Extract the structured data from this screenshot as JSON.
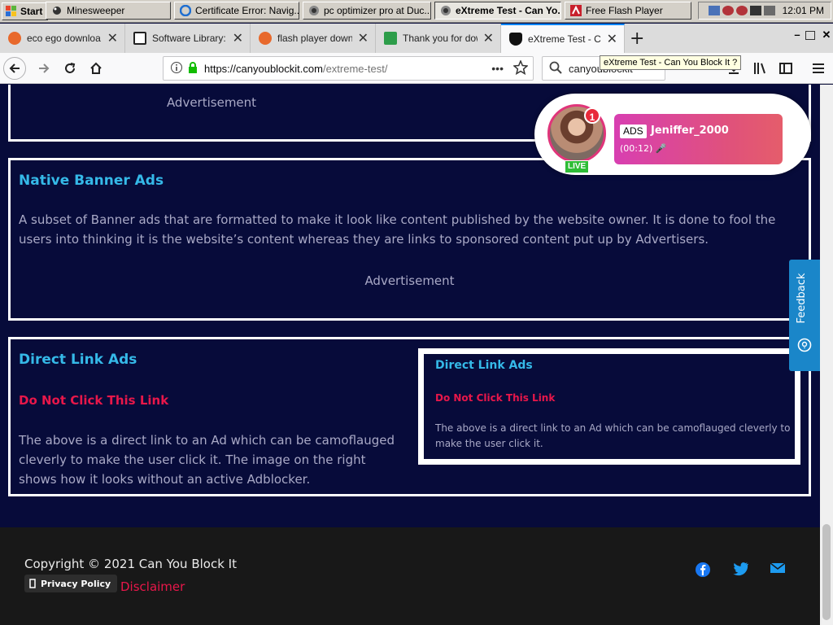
{
  "taskbar": {
    "start_label": "Start",
    "tasks": [
      {
        "label": "Minesweeper"
      },
      {
        "label": "Certificate Error: Navig..."
      },
      {
        "label": "pc optimizer pro at Duc..."
      },
      {
        "label": "eXtreme Test - Can Yo..."
      },
      {
        "label": "Free Flash Player"
      }
    ],
    "clock": "12:01 PM"
  },
  "tabs": [
    {
      "title": "eco ego downloa"
    },
    {
      "title": "Software Library: F"
    },
    {
      "title": "flash player downl"
    },
    {
      "title": "Thank you for dow"
    },
    {
      "title": "eXtreme Test - Can"
    }
  ],
  "navbar": {
    "url_domain": "https://canyoublockit.com",
    "url_path": "/extreme-test/",
    "search_value": "canyoublockit",
    "tooltip": "eXtreme Test - Can You Block It ?"
  },
  "page": {
    "top_ad_label": "Advertisement",
    "native": {
      "title": "Native Banner Ads",
      "text_line1": "A subset of Banner ads that are formatted to make it look like content published by the website owner. It is done to fool the",
      "text_line2": "users into thinking it is the website’s content whereas they are links to sponsored content put up by Advertisers.",
      "ad_label": "Advertisement"
    },
    "direct": {
      "title": "Direct Link Ads",
      "link": "Do Not Click This Link",
      "text_line1": "The above is a direct link to an Ad which can be camoflauged",
      "text_line2": "cleverly to make the user click it. The image on the right",
      "text_line3": "shows how it looks without an active Adblocker.",
      "preview_title": "Direct Link Ads",
      "preview_link": "Do Not Click This Link",
      "preview_line1": "The above is a direct link to an Ad which can be camoflauged cleverly to",
      "preview_line2": "make the user click it."
    },
    "live_widget": {
      "notif_count": "1",
      "live": "LIVE",
      "ads": "ADS",
      "user": "Jeniffer_2000",
      "time": "(00:12)"
    },
    "feedback": "Feedback",
    "footer": {
      "copyright": "Copyright © 2021 Can You Block It",
      "privacy": "Privacy Policy",
      "disclaimer": "Disclaimer"
    }
  },
  "colors": {
    "page_bg": "#070b3a",
    "title": "#35b9e8",
    "link_red": "#e8174a",
    "footer_bg": "#181818",
    "feedback_blue": "#1a86c9"
  }
}
